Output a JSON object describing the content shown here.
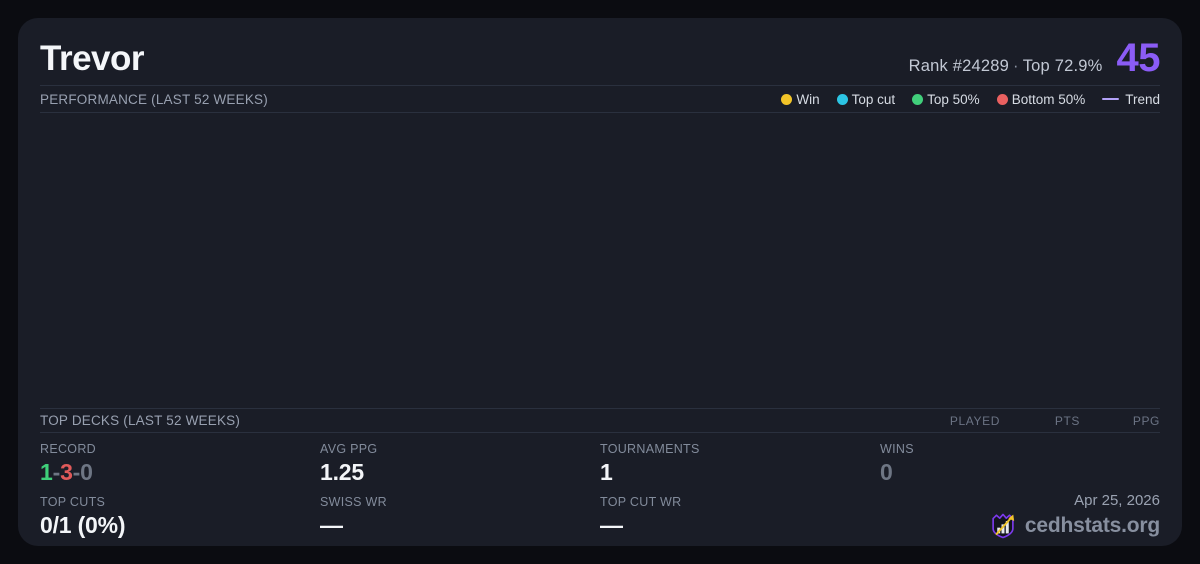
{
  "header": {
    "title": "Trevor",
    "rank": "Rank #24289",
    "dot_separator": "·",
    "top_percent": "Top 72.9%",
    "score": "45",
    "score_color": "#8b5cf6"
  },
  "performance": {
    "title": "PERFORMANCE (LAST 52 WEEKS)",
    "legend": [
      {
        "label": "Win",
        "color": "#f2c428",
        "marker": "dot"
      },
      {
        "label": "Top cut",
        "color": "#2cc5e4",
        "marker": "dot"
      },
      {
        "label": "Top 50%",
        "color": "#41cf7b",
        "marker": "dot"
      },
      {
        "label": "Bottom 50%",
        "color": "#ea6060",
        "marker": "dot"
      },
      {
        "label": "Trend",
        "color": "#b2a1f7",
        "marker": "line"
      }
    ]
  },
  "chart_data": {
    "type": "scatter",
    "title": "PERFORMANCE (LAST 52 WEEKS)",
    "points": [],
    "series": [],
    "note": "chart plot area is empty in the screenshot"
  },
  "top_decks": {
    "title": "TOP DECKS (LAST 52 WEEKS)",
    "columns": [
      "PLAYED",
      "PTS",
      "PPG"
    ],
    "rows": []
  },
  "stats": {
    "record": {
      "label": "RECORD",
      "wins": "1",
      "sep1": "-",
      "losses": "3",
      "sep2": "-",
      "draws": "0",
      "win_color": "#3fd07a",
      "loss_color": "#e05a5a",
      "muted_color": "#6e7684"
    },
    "avg_ppg": {
      "label": "AVG PPG",
      "value": "1.25"
    },
    "tournaments": {
      "label": "TOURNAMENTS",
      "value": "1"
    },
    "wins": {
      "label": "WINS",
      "value": "0"
    },
    "top_cuts": {
      "label": "TOP CUTS",
      "value": "0/1 (0%)"
    },
    "swiss_wr": {
      "label": "SWISS WR",
      "value": "—"
    },
    "top_cut_wr": {
      "label": "TOP CUT WR",
      "value": "—"
    }
  },
  "footer": {
    "date": "Apr 25, 2026",
    "brand": "cedhstats.org",
    "logo_shield_color": "#7c3aed",
    "logo_arrow_color": "#f0c32a"
  }
}
